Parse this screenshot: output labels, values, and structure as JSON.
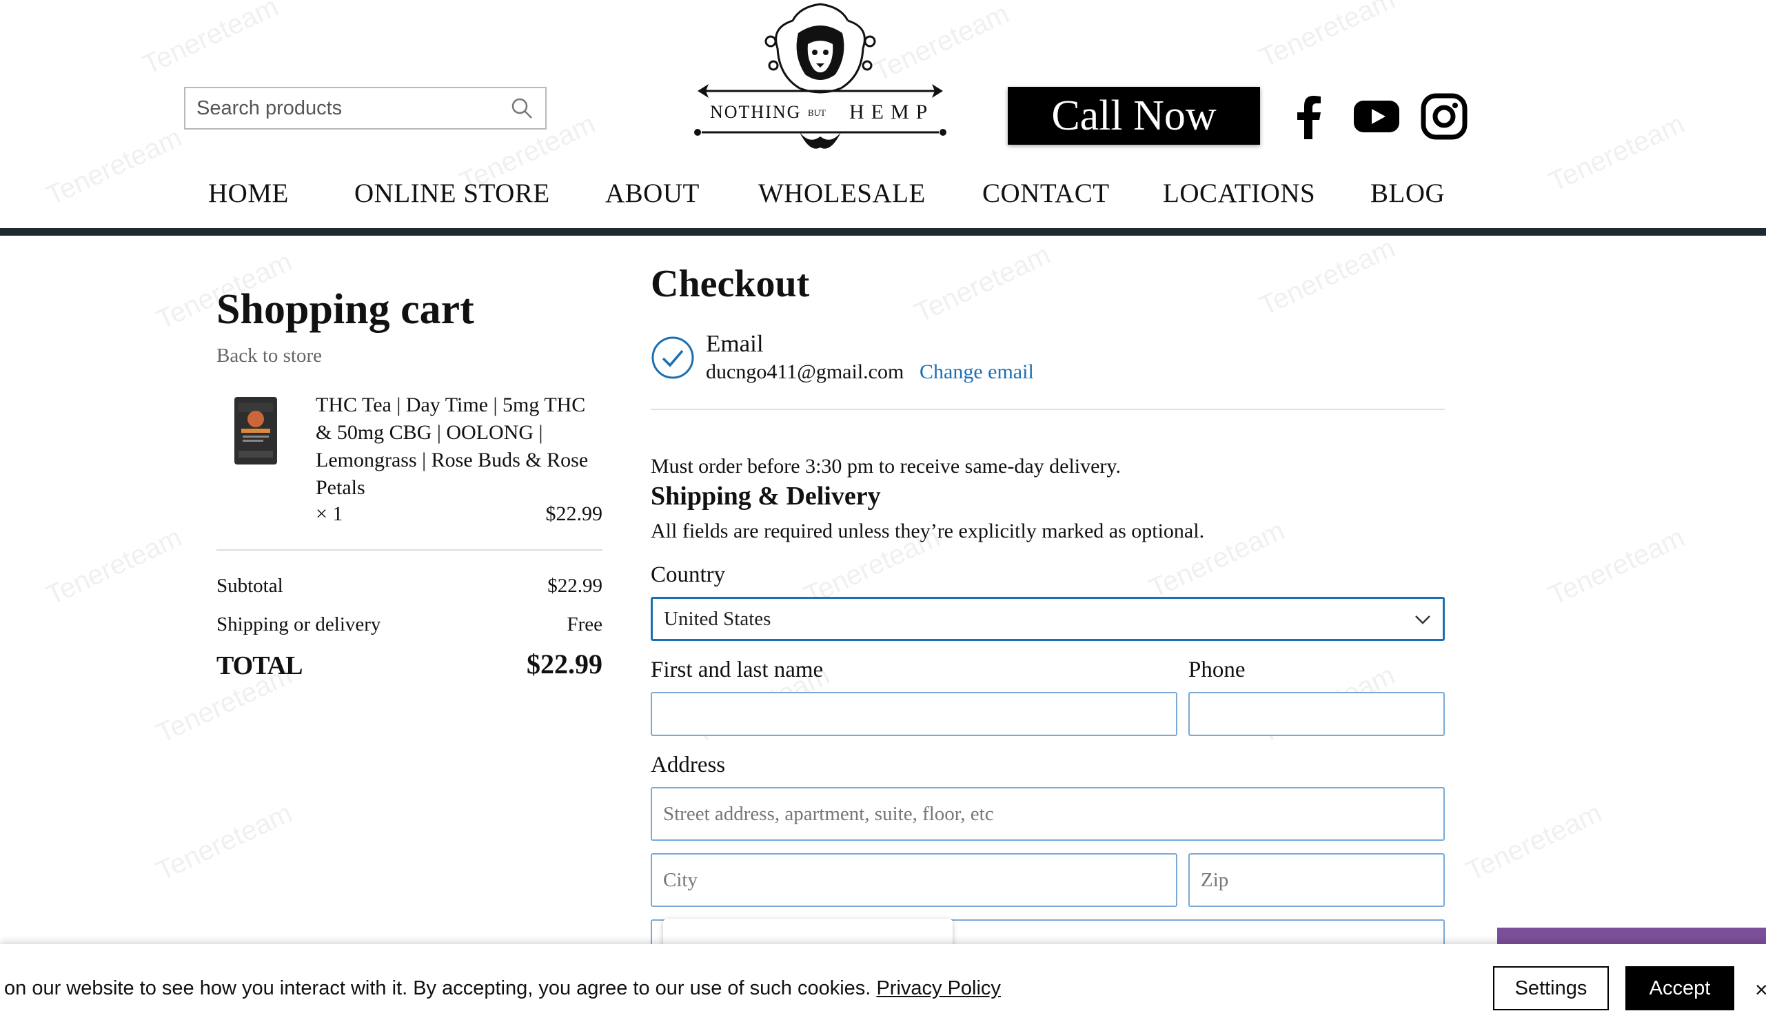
{
  "header": {
    "search_placeholder": "Search products",
    "logo": {
      "word_left": "NOTHING",
      "word_mid": "BUT",
      "word_right": "HEMP"
    },
    "call_button": "Call Now",
    "social": [
      "facebook-icon",
      "youtube-icon",
      "instagram-icon"
    ]
  },
  "nav": {
    "items": [
      "HOME",
      "ONLINE STORE",
      "ABOUT",
      "WHOLESALE",
      "CONTACT",
      "LOCATIONS",
      "BLOG"
    ]
  },
  "cart": {
    "title": "Shopping cart",
    "back_link": "Back to store",
    "item": {
      "name": "THC Tea | Day Time | 5mg THC & 50mg CBG | OOLONG | Lemongrass | Rose Buds & Rose Petals",
      "qty": "× 1",
      "price": "$22.99"
    },
    "subtotal_label": "Subtotal",
    "subtotal_value": "$22.99",
    "shipping_label": "Shipping or delivery",
    "shipping_value": "Free",
    "total_label": "TOTAL",
    "total_value": "$22.99"
  },
  "checkout": {
    "title": "Checkout",
    "email_label": "Email",
    "email_value": "ducngo411@gmail.com",
    "change_email": "Change email",
    "notice": "Must order before 3:30 pm to receive same-day delivery.",
    "section_title": "Shipping & Delivery",
    "required_note": "All fields are required unless they’re explicitly marked as optional.",
    "country_label": "Country",
    "country_value": "United States",
    "name_label": "First and last name",
    "phone_label": "Phone",
    "address_label": "Address",
    "address_placeholder": "Street address, apartment, suite, floor, etc",
    "city_placeholder": "City",
    "zip_placeholder": "Zip"
  },
  "cookie": {
    "text": "on our website to see how you interact with it. By accepting, you agree to our use of such cookies.",
    "privacy_link": "Privacy Policy",
    "settings_button": "Settings",
    "accept_button": "Accept",
    "close": "×"
  },
  "colors": {
    "accent_blue": "#1a6fb3",
    "nav_rule": "#1e2a30",
    "purple_tab": "#7b4f9a"
  },
  "watermark": "Tenereteam"
}
